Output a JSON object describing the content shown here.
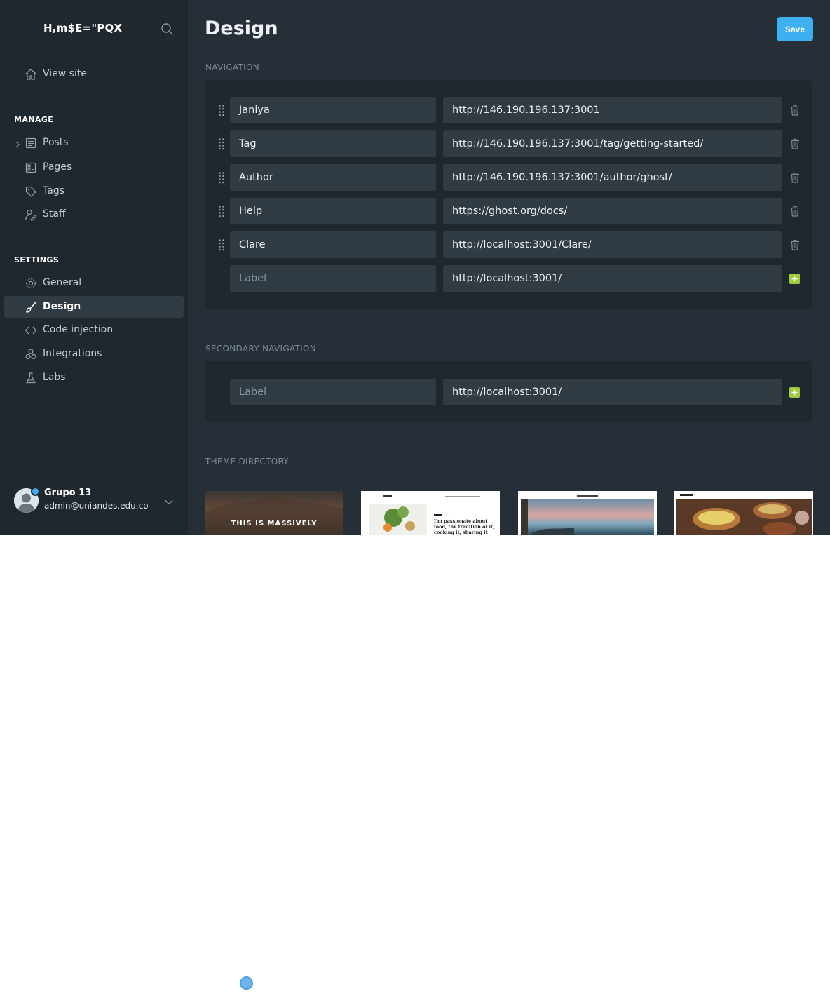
{
  "sidebar": {
    "brand": "H,m$E=\"PQX",
    "view_site": "View site",
    "manage_heading": "MANAGE",
    "manage_items": [
      "Posts",
      "Pages",
      "Tags",
      "Staff"
    ],
    "settings_heading": "SETTINGS",
    "settings_items": [
      "General",
      "Design",
      "Code injection",
      "Integrations",
      "Labs"
    ],
    "active_item": "Design",
    "user": {
      "name": "Grupo 13",
      "email": "admin@uniandes.edu.co"
    }
  },
  "header": {
    "title": "Design",
    "save_label": "Save"
  },
  "navigation": {
    "heading": "NAVIGATION",
    "items": [
      {
        "label": "Janiya",
        "url": "http://146.190.196.137:3001"
      },
      {
        "label": "Tag",
        "url": "http://146.190.196.137:3001/tag/getting-started/"
      },
      {
        "label": "Author",
        "url": "http://146.190.196.137:3001/author/ghost/"
      },
      {
        "label": "Help",
        "url": "https://ghost.org/docs/"
      },
      {
        "label": "Clare",
        "url": "http://localhost:3001/Clare/"
      }
    ],
    "new_item": {
      "label_placeholder": "Label",
      "url": "http://localhost:3001/"
    }
  },
  "secondary_navigation": {
    "heading": "SECONDARY NAVIGATION",
    "new_item": {
      "label_placeholder": "Label",
      "url": "http://localhost:3001/"
    }
  },
  "theme_directory": {
    "heading": "THEME DIRECTORY",
    "themes": [
      {
        "preview_text": "THIS IS MASSIVELY"
      },
      {
        "preview_text": "I'm passionate about food, the tradition of it, cooking it, sharing it"
      },
      {
        "preview_text": ""
      },
      {
        "preview_text": ""
      }
    ]
  },
  "colors": {
    "accent": "#3eb0ef",
    "add": "#9fcb3d",
    "sidebar_bg": "#1f282f",
    "main_bg": "#262f37"
  }
}
